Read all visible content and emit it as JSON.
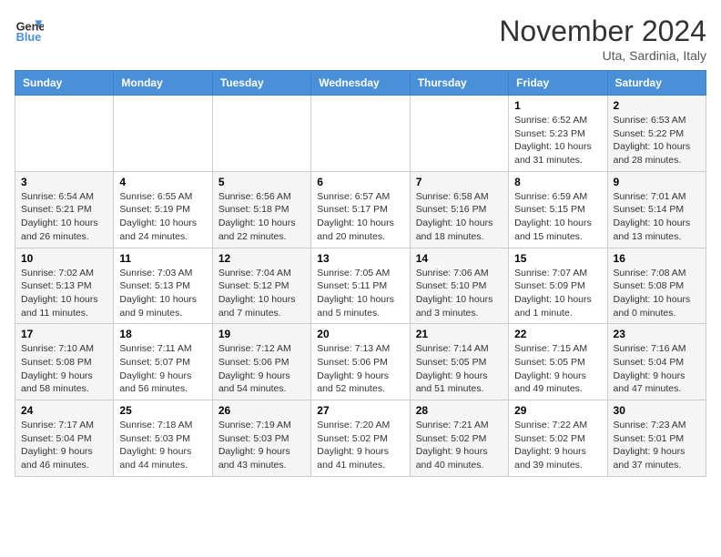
{
  "header": {
    "logo_line1": "General",
    "logo_line2": "Blue",
    "month_title": "November 2024",
    "location": "Uta, Sardinia, Italy"
  },
  "weekdays": [
    "Sunday",
    "Monday",
    "Tuesday",
    "Wednesday",
    "Thursday",
    "Friday",
    "Saturday"
  ],
  "weeks": [
    [
      {
        "day": "",
        "info": ""
      },
      {
        "day": "",
        "info": ""
      },
      {
        "day": "",
        "info": ""
      },
      {
        "day": "",
        "info": ""
      },
      {
        "day": "",
        "info": ""
      },
      {
        "day": "1",
        "info": "Sunrise: 6:52 AM\nSunset: 5:23 PM\nDaylight: 10 hours and 31 minutes."
      },
      {
        "day": "2",
        "info": "Sunrise: 6:53 AM\nSunset: 5:22 PM\nDaylight: 10 hours and 28 minutes."
      }
    ],
    [
      {
        "day": "3",
        "info": "Sunrise: 6:54 AM\nSunset: 5:21 PM\nDaylight: 10 hours and 26 minutes."
      },
      {
        "day": "4",
        "info": "Sunrise: 6:55 AM\nSunset: 5:19 PM\nDaylight: 10 hours and 24 minutes."
      },
      {
        "day": "5",
        "info": "Sunrise: 6:56 AM\nSunset: 5:18 PM\nDaylight: 10 hours and 22 minutes."
      },
      {
        "day": "6",
        "info": "Sunrise: 6:57 AM\nSunset: 5:17 PM\nDaylight: 10 hours and 20 minutes."
      },
      {
        "day": "7",
        "info": "Sunrise: 6:58 AM\nSunset: 5:16 PM\nDaylight: 10 hours and 18 minutes."
      },
      {
        "day": "8",
        "info": "Sunrise: 6:59 AM\nSunset: 5:15 PM\nDaylight: 10 hours and 15 minutes."
      },
      {
        "day": "9",
        "info": "Sunrise: 7:01 AM\nSunset: 5:14 PM\nDaylight: 10 hours and 13 minutes."
      }
    ],
    [
      {
        "day": "10",
        "info": "Sunrise: 7:02 AM\nSunset: 5:13 PM\nDaylight: 10 hours and 11 minutes."
      },
      {
        "day": "11",
        "info": "Sunrise: 7:03 AM\nSunset: 5:13 PM\nDaylight: 10 hours and 9 minutes."
      },
      {
        "day": "12",
        "info": "Sunrise: 7:04 AM\nSunset: 5:12 PM\nDaylight: 10 hours and 7 minutes."
      },
      {
        "day": "13",
        "info": "Sunrise: 7:05 AM\nSunset: 5:11 PM\nDaylight: 10 hours and 5 minutes."
      },
      {
        "day": "14",
        "info": "Sunrise: 7:06 AM\nSunset: 5:10 PM\nDaylight: 10 hours and 3 minutes."
      },
      {
        "day": "15",
        "info": "Sunrise: 7:07 AM\nSunset: 5:09 PM\nDaylight: 10 hours and 1 minute."
      },
      {
        "day": "16",
        "info": "Sunrise: 7:08 AM\nSunset: 5:08 PM\nDaylight: 10 hours and 0 minutes."
      }
    ],
    [
      {
        "day": "17",
        "info": "Sunrise: 7:10 AM\nSunset: 5:08 PM\nDaylight: 9 hours and 58 minutes."
      },
      {
        "day": "18",
        "info": "Sunrise: 7:11 AM\nSunset: 5:07 PM\nDaylight: 9 hours and 56 minutes."
      },
      {
        "day": "19",
        "info": "Sunrise: 7:12 AM\nSunset: 5:06 PM\nDaylight: 9 hours and 54 minutes."
      },
      {
        "day": "20",
        "info": "Sunrise: 7:13 AM\nSunset: 5:06 PM\nDaylight: 9 hours and 52 minutes."
      },
      {
        "day": "21",
        "info": "Sunrise: 7:14 AM\nSunset: 5:05 PM\nDaylight: 9 hours and 51 minutes."
      },
      {
        "day": "22",
        "info": "Sunrise: 7:15 AM\nSunset: 5:05 PM\nDaylight: 9 hours and 49 minutes."
      },
      {
        "day": "23",
        "info": "Sunrise: 7:16 AM\nSunset: 5:04 PM\nDaylight: 9 hours and 47 minutes."
      }
    ],
    [
      {
        "day": "24",
        "info": "Sunrise: 7:17 AM\nSunset: 5:04 PM\nDaylight: 9 hours and 46 minutes."
      },
      {
        "day": "25",
        "info": "Sunrise: 7:18 AM\nSunset: 5:03 PM\nDaylight: 9 hours and 44 minutes."
      },
      {
        "day": "26",
        "info": "Sunrise: 7:19 AM\nSunset: 5:03 PM\nDaylight: 9 hours and 43 minutes."
      },
      {
        "day": "27",
        "info": "Sunrise: 7:20 AM\nSunset: 5:02 PM\nDaylight: 9 hours and 41 minutes."
      },
      {
        "day": "28",
        "info": "Sunrise: 7:21 AM\nSunset: 5:02 PM\nDaylight: 9 hours and 40 minutes."
      },
      {
        "day": "29",
        "info": "Sunrise: 7:22 AM\nSunset: 5:02 PM\nDaylight: 9 hours and 39 minutes."
      },
      {
        "day": "30",
        "info": "Sunrise: 7:23 AM\nSunset: 5:01 PM\nDaylight: 9 hours and 37 minutes."
      }
    ]
  ]
}
